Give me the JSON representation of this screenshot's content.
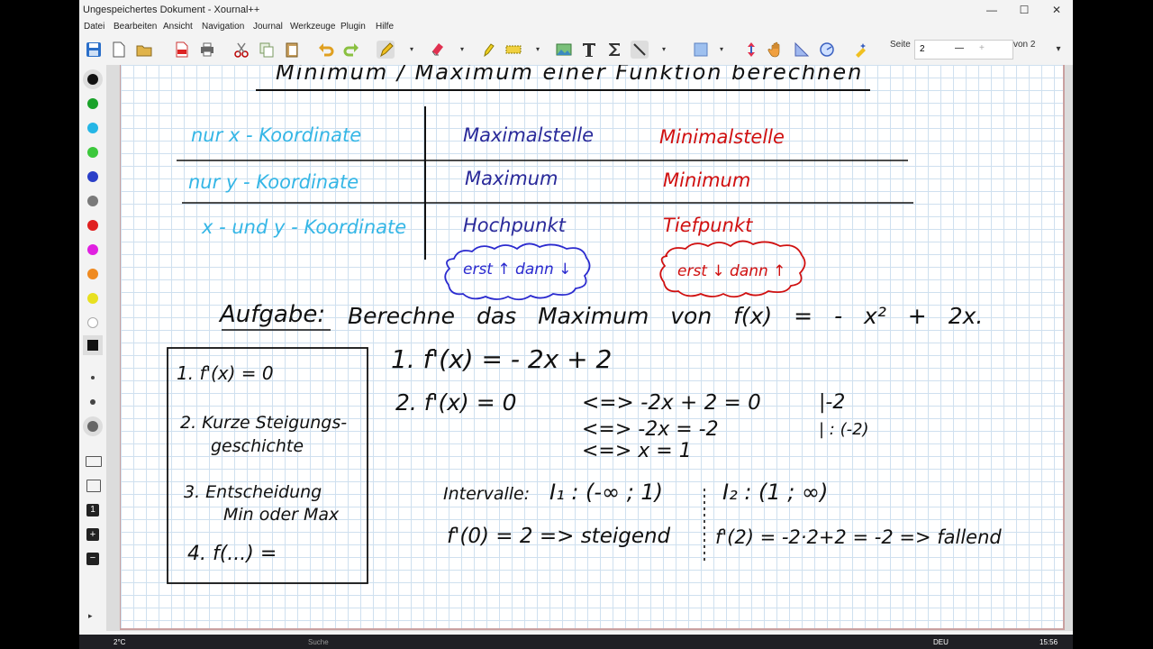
{
  "window": {
    "title": "Ungespeichertes Dokument - Xournal++",
    "controls": [
      "—",
      "☐",
      "✕"
    ]
  },
  "menu": [
    "Datei",
    "Bearbeiten",
    "Ansicht",
    "Navigation",
    "Journal",
    "Werkzeuge",
    "Plugin",
    "Hilfe"
  ],
  "toolbar": {
    "page_label": "Seite",
    "page_value": "2",
    "page_minus": "—",
    "page_plus": "+",
    "page_of": "von 2",
    "menu_chevron": "▾"
  },
  "colors": {
    "palette": [
      "#111111",
      "#1aa22a",
      "#25b6e6",
      "#3cc83c",
      "#2a3fc8",
      "#7a7a7a",
      "#e02020",
      "#e020e0",
      "#ef8a20",
      "#e8e020",
      "#ffffff"
    ],
    "cyan_ink": "#35b6e6",
    "blue_ink": "#2a2a9a",
    "red_ink": "#d01010",
    "black_ink": "#111111"
  },
  "notes": {
    "heading": "Minimum / Maximum einer Funktion berechnen",
    "table": {
      "rows": [
        {
          "label": "nur x - Koordinate",
          "max": "Maximalstelle",
          "min": "Minimalstelle"
        },
        {
          "label": "nur y - Koordinate",
          "max": "Maximum",
          "min": "Minimum"
        },
        {
          "label": "x - und y - Koordinate",
          "max": "Hochpunkt",
          "min": "Tiefpunkt"
        }
      ],
      "cloud_max": "erst ↑ dann ↓",
      "cloud_min": "erst ↓ dann ↑"
    },
    "task_label": "Aufgabe:",
    "task_text": "Berechne das Maximum von f(x) = - x² + 2x.",
    "steps": [
      "1. f'(x) = 0",
      "2. Kurze Steigungs-",
      "geschichte",
      "3. Entscheidung",
      "Min oder Max",
      "4. f(...) ="
    ],
    "solution": {
      "line1": "1. f'(x) = - 2x + 2",
      "line2a": "2. f'(x) = 0",
      "line2b": "<=>  -2x + 2 = 0",
      "line2c": "|-2",
      "line3b": "<=>  -2x = -2",
      "line3c": "| : (-2)",
      "line4b": "<=>  x = 1",
      "intervals_label": "Intervalle:",
      "interval1": "I₁ : (-∞ ; 1)",
      "interval2": "I₂ : (1 ; ∞)",
      "eval1": "f'(0) = 2  =>  steigend",
      "eval2": "f'(2) = -2·2+2 = -2 => fallend"
    }
  },
  "taskbar": {
    "weather": "2°C",
    "search": "Suche",
    "lang": "DEU",
    "time": "15:56"
  }
}
